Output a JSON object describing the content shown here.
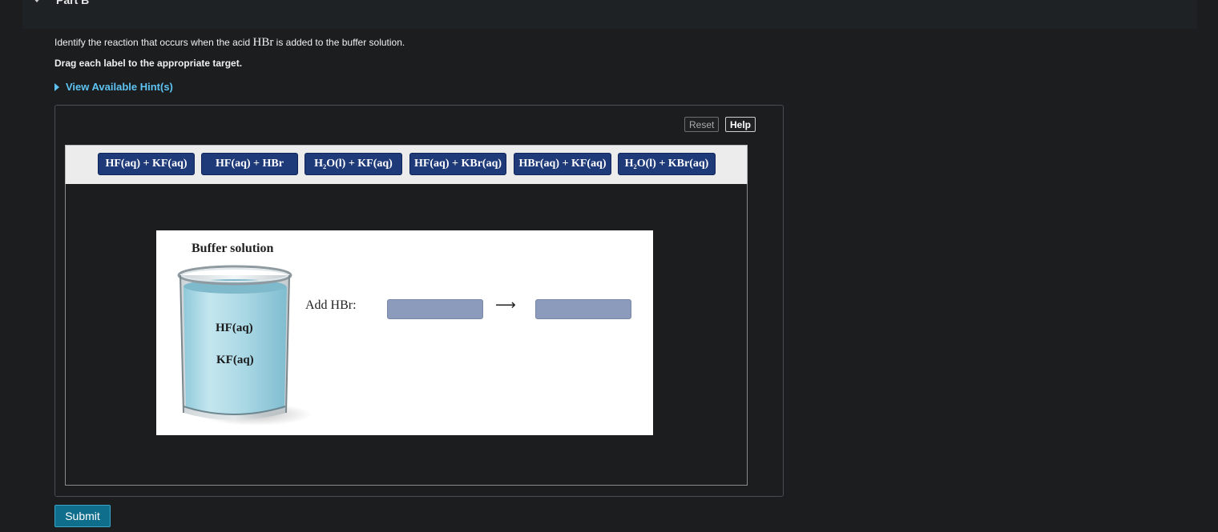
{
  "part": {
    "title": "Part B"
  },
  "question": {
    "prefix": "Identify the reaction that occurs when the acid ",
    "acid": "HBr",
    "suffix": " is added to the buffer solution.",
    "drag_instruction": "Drag each label to the appropriate target.",
    "hints_label": "View Available Hint(s)"
  },
  "toolbar": {
    "reset_label": "Reset",
    "help_label": "Help"
  },
  "labels": [
    "HF(aq) + KF(aq)",
    "HF(aq) + HBr",
    "H₂O(l) + KF(aq)",
    "HF(aq) + KBr(aq)",
    "HBr(aq) + KF(aq)",
    "H₂O(l) + KBr(aq)"
  ],
  "figure": {
    "title": "Buffer solution",
    "beaker_labels": [
      "HF(aq)",
      "KF(aq)"
    ],
    "add_text": "Add HBr:",
    "arrow": "⟶"
  },
  "submit_label": "Submit",
  "colors": {
    "background": "#1b1d1f",
    "hint_link": "#5ec3f2",
    "chip_bg": "#1f3a78",
    "target_bg": "#8c9abb",
    "submit_bg": "#0f6e8c"
  }
}
